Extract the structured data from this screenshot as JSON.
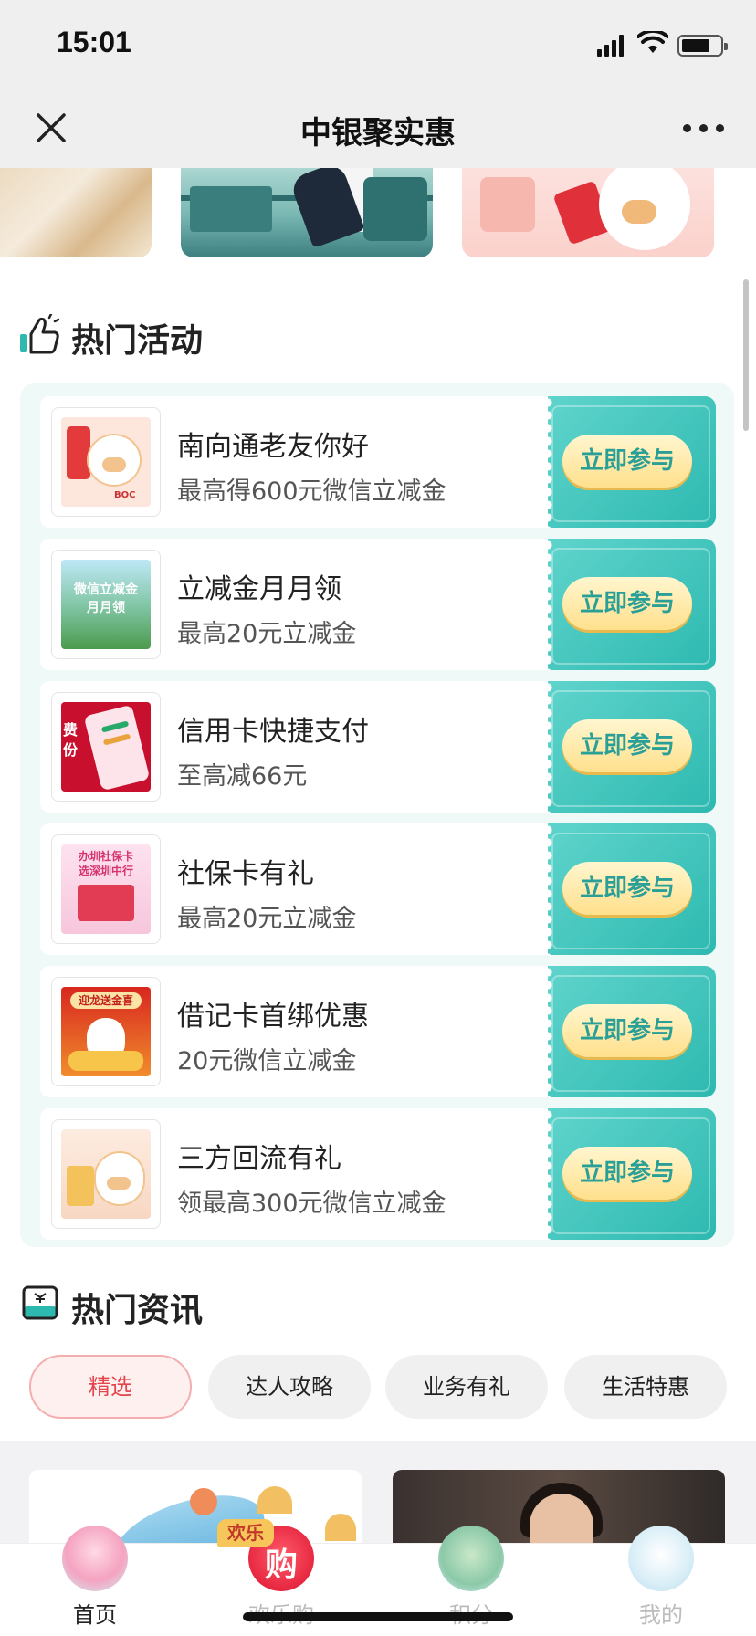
{
  "status_bar": {
    "time": "15:01"
  },
  "nav": {
    "title": "中银聚实惠"
  },
  "hot_activities": {
    "title": "热门活动",
    "items": [
      {
        "title": "南向通老友你好",
        "subtitle": "最高得600元微信立减金",
        "button": "立即参与"
      },
      {
        "title": "立减金月月领",
        "subtitle": "最高20元立减金",
        "button": "立即参与"
      },
      {
        "title": "信用卡快捷支付",
        "subtitle": "至高减66元",
        "button": "立即参与"
      },
      {
        "title": "社保卡有礼",
        "subtitle": "最高20元立减金",
        "button": "立即参与"
      },
      {
        "title": "借记卡首绑优惠",
        "subtitle": "20元微信立减金",
        "button": "立即参与"
      },
      {
        "title": "三方回流有礼",
        "subtitle": "领最高300元微信立减金",
        "button": "立即参与"
      }
    ]
  },
  "thumb_texts": {
    "t1_badge": "BOC",
    "t2_line1": "微信立减金",
    "t2_line2": "月月领",
    "t3_text": "费\n份",
    "t4_line1": "办圳社保卡",
    "t4_line2": "选深圳中行",
    "t5_text": "迎龙送金喜"
  },
  "hot_news": {
    "title": "热门资讯",
    "tabs": [
      {
        "label": "精选",
        "active": true
      },
      {
        "label": "达人攻略",
        "active": false
      },
      {
        "label": "业务有礼",
        "active": false
      },
      {
        "label": "生活特惠",
        "active": false
      }
    ]
  },
  "tab_bar": {
    "items": [
      {
        "label": "首页",
        "active": true
      },
      {
        "label": "欢乐购",
        "active": false
      },
      {
        "label": "积分",
        "active": false
      },
      {
        "label": "我的",
        "active": false
      }
    ],
    "badge": "欢乐",
    "huanle_glyph": "购"
  },
  "colors": {
    "teal": "#2db9b0",
    "button_text": "#2a9f97",
    "active_tab_text": "#e2454c",
    "active_tab_bg": "#fff0f0"
  }
}
